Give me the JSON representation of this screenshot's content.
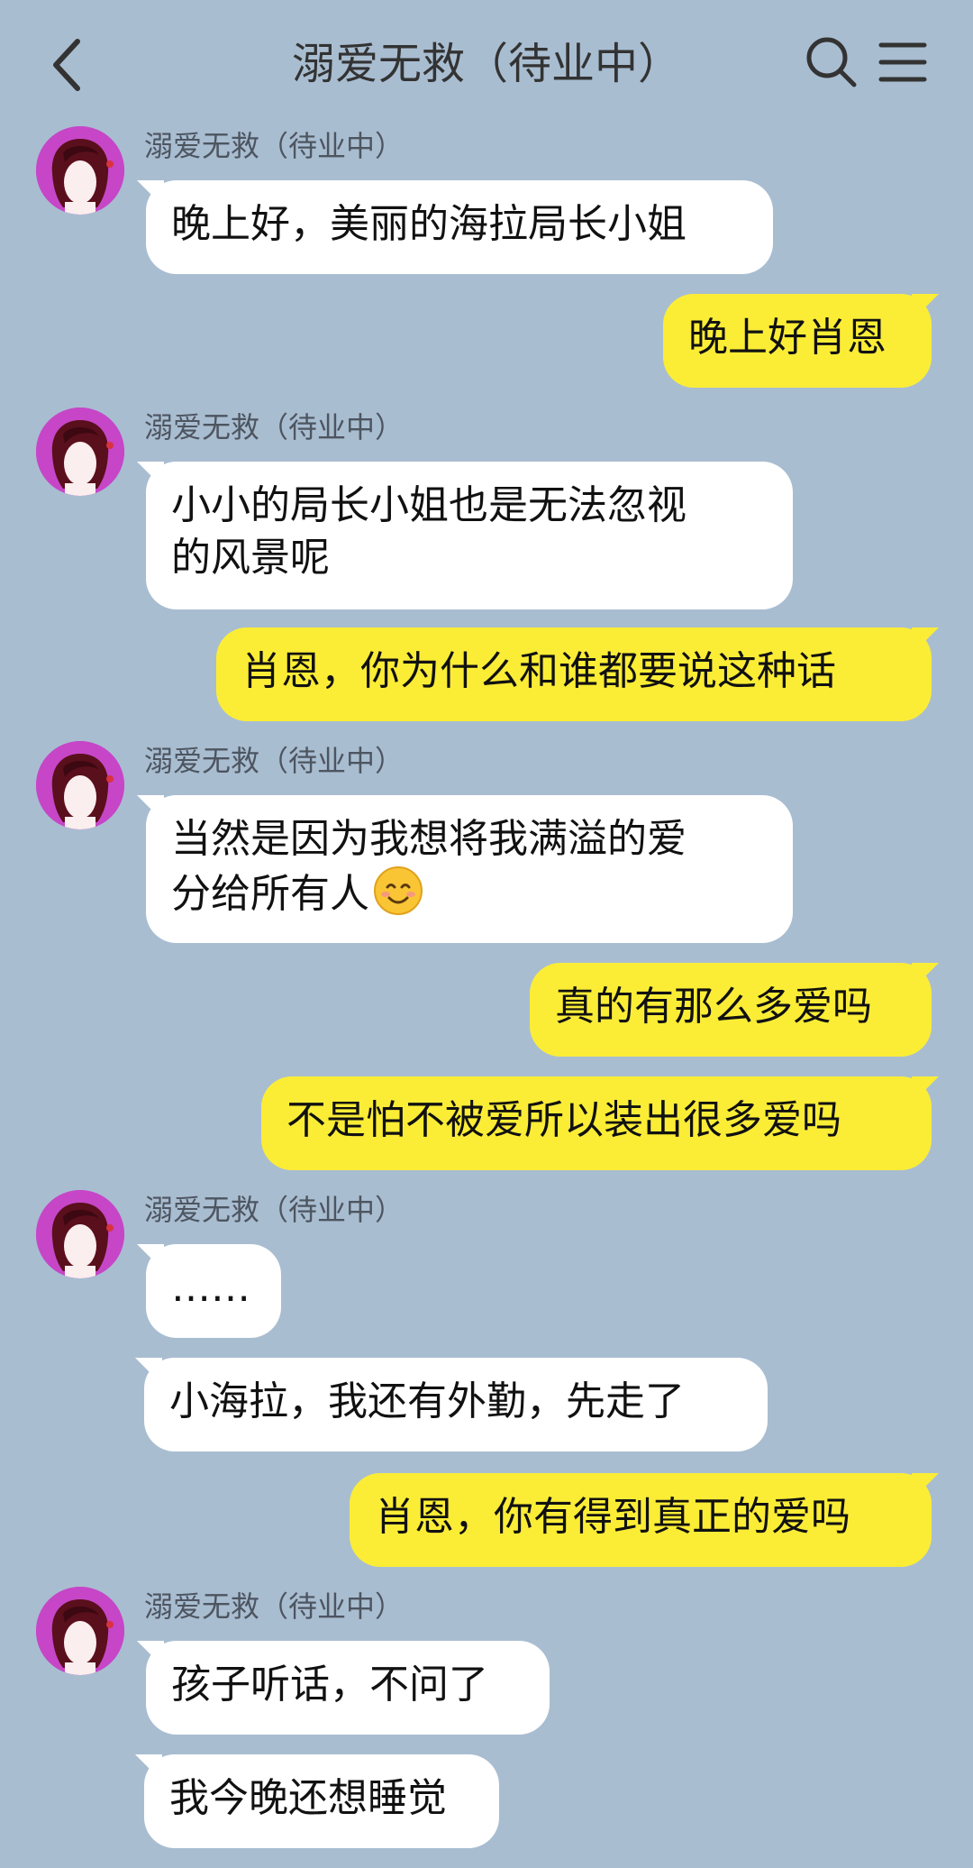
{
  "header": {
    "title": "溺爱无救（待业中）"
  },
  "messages": [
    {
      "sender": "溺爱无救（待业中）",
      "text": "晚上好，美丽的海拉局长小姐"
    },
    {
      "text": "晚上好肖恩"
    },
    {
      "sender": "溺爱无救（待业中）",
      "text": "小小的局长小姐也是无法忽视\n的风景呢"
    },
    {
      "text": "肖恩，你为什么和谁都要说这种话"
    },
    {
      "sender": "溺爱无救（待业中）",
      "text": "当然是因为我想将我满溢的爱\n分给所有人",
      "emoji": "smiling-face-emoji"
    },
    {
      "text": "真的有那么多爱吗"
    },
    {
      "text": "不是怕不被爱所以装出很多爱吗"
    },
    {
      "sender": "溺爱无救（待业中）",
      "text": "……"
    },
    {
      "text": "小海拉，我还有外勤，先走了"
    },
    {
      "text": "肖恩，你有得到真正的爱吗"
    },
    {
      "sender": "溺爱无救（待业中）",
      "text": "孩子听话，不问了"
    },
    {
      "text": "我今晚还想睡觉"
    }
  ],
  "colors": {
    "background": "#a9bdd1",
    "incoming_bubble": "#ffffff",
    "outgoing_bubble": "#fbed36",
    "avatar": "#c646c7"
  },
  "icons": [
    "back-arrow-icon",
    "search-icon",
    "menu-icon"
  ]
}
